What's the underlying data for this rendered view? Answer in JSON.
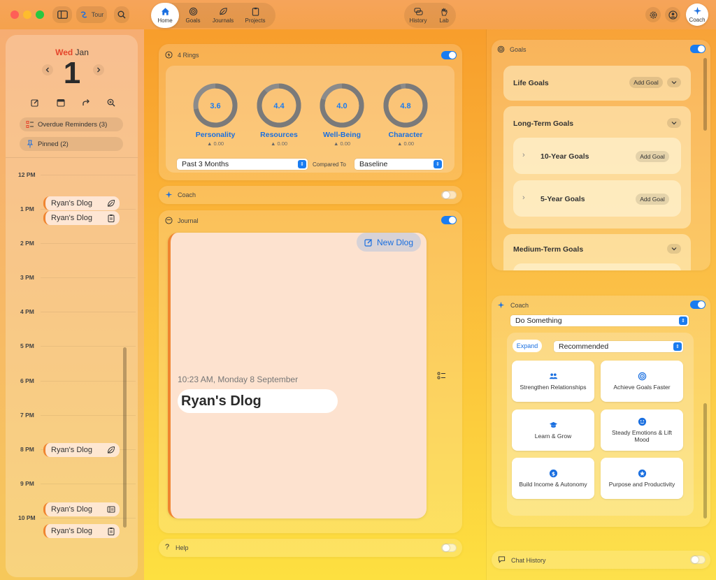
{
  "toolbar": {
    "tour_label": "Tour",
    "nav": [
      {
        "label": "Home",
        "icon": "house-icon"
      },
      {
        "label": "Goals",
        "icon": "target-icon"
      },
      {
        "label": "Journals",
        "icon": "leaf-icon"
      },
      {
        "label": "Projects",
        "icon": "clipboard-icon"
      }
    ],
    "history_label": "History",
    "lab_label": "Lab",
    "coach_label": "Coach"
  },
  "calendar": {
    "weekday": "Wed",
    "month": "Jan",
    "day": "1",
    "overdue_label": "Overdue Reminders (3)",
    "pinned_label": "Pinned (2)",
    "hours": [
      "12 PM",
      "1 PM",
      "2 PM",
      "3 PM",
      "4 PM",
      "5 PM",
      "6 PM",
      "7 PM",
      "8 PM",
      "9 PM",
      "10 PM"
    ],
    "events": [
      {
        "label": "Ryan's Dlog",
        "icon": "leaf-icon"
      },
      {
        "label": "Ryan's Dlog",
        "icon": "clipboard-icon"
      },
      {
        "label": "Ryan's Dlog",
        "icon": "leaf-icon"
      },
      {
        "label": "Ryan's Dlog",
        "icon": "list-icon"
      },
      {
        "label": "Ryan's Dlog",
        "icon": "clipboard-icon"
      }
    ]
  },
  "rings": {
    "title": "4 Rings",
    "items": [
      {
        "name": "Personality",
        "value": "3.6",
        "delta": "▲ 0.00",
        "fill": 0.72
      },
      {
        "name": "Resources",
        "value": "4.4",
        "delta": "▲ 0.00",
        "fill": 0.88
      },
      {
        "name": "Well-Being",
        "value": "4.0",
        "delta": "▲ 0.00",
        "fill": 0.8
      },
      {
        "name": "Character",
        "value": "4.8",
        "delta": "▲ 0.00",
        "fill": 0.96
      }
    ],
    "period": "Past 3 Months",
    "compared_to_label": "Compared To",
    "baseline": "Baseline"
  },
  "coach_bar": {
    "title": "Coach"
  },
  "journal": {
    "title": "Journal",
    "new_button": "New Dlog",
    "timestamp": "10:23 AM, Monday 8 September",
    "entry_title": "Ryan's Dlog"
  },
  "help": {
    "title": "Help"
  },
  "goals": {
    "title": "Goals",
    "life_goals": "Life Goals",
    "add_goal": "Add Goal",
    "long_term": "Long-Term Goals",
    "ten_year": "10-Year Goals",
    "five_year": "5-Year Goals",
    "medium_term": "Medium-Term Goals"
  },
  "coach": {
    "title": "Coach",
    "mode": "Do Something",
    "expand": "Expand",
    "filter": "Recommended",
    "tiles": [
      {
        "label": "Strengthen Relationships",
        "icon": "people-icon"
      },
      {
        "label": "Achieve Goals Faster",
        "icon": "target-icon"
      },
      {
        "label": "Learn & Grow",
        "icon": "graduation-cap-icon"
      },
      {
        "label": "Steady Emotions & Lift Mood",
        "icon": "smiley-icon"
      },
      {
        "label": "Build Income & Autonomy",
        "icon": "dollar-icon"
      },
      {
        "label": "Purpose and Productivity",
        "icon": "star-icon"
      }
    ]
  },
  "chat_history": {
    "title": "Chat History"
  },
  "colors": {
    "accent": "#1a7cf0",
    "ring_track": "#8b8b8b",
    "weekday_red": "#e5452b"
  }
}
